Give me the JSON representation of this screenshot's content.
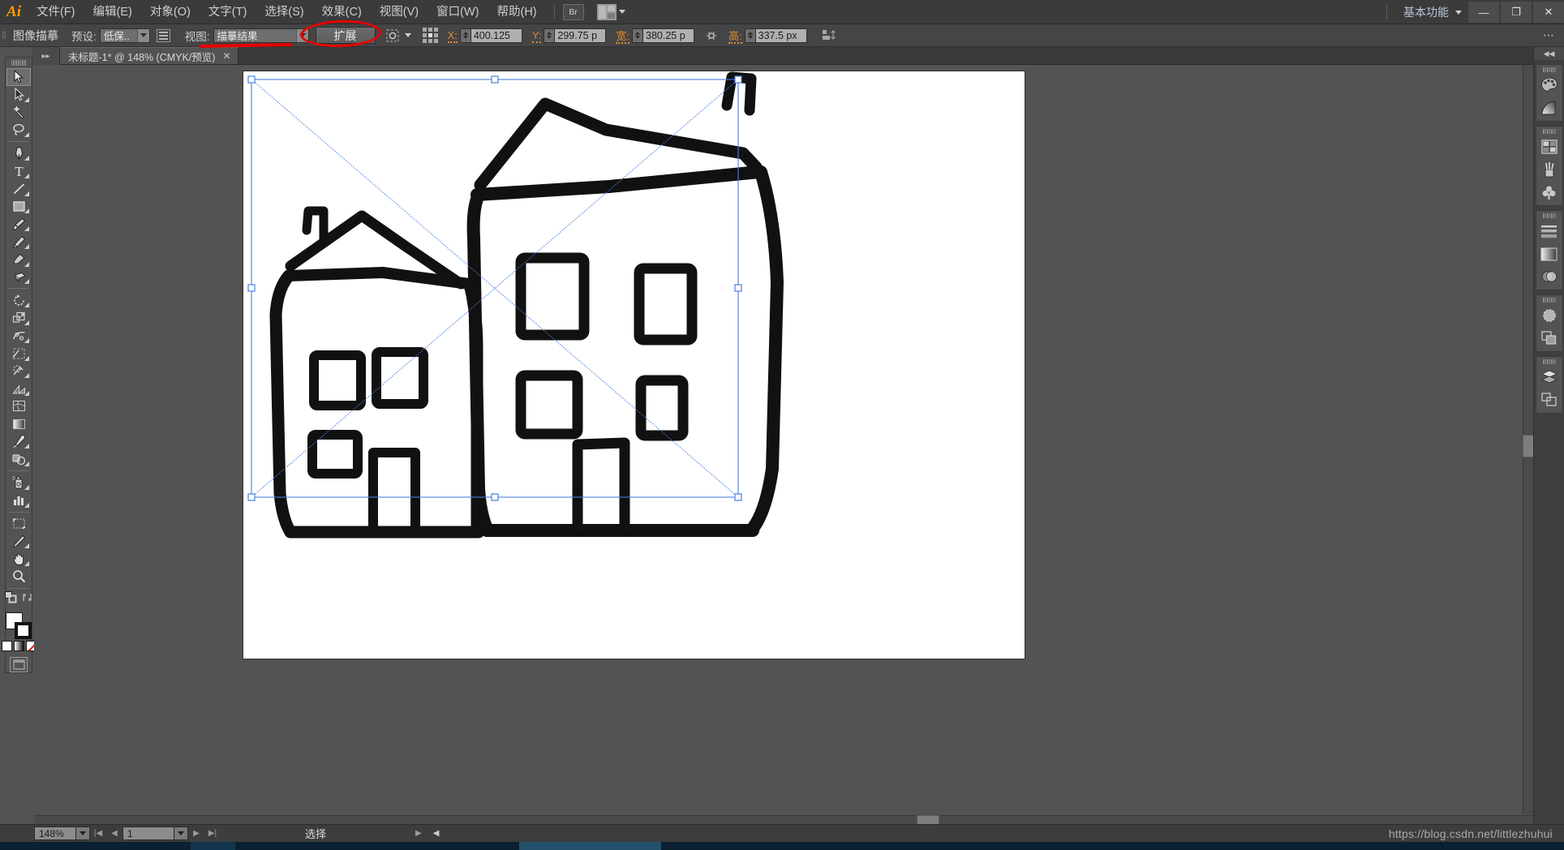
{
  "app": {
    "name": "Adobe Illustrator",
    "logo": "Ai"
  },
  "menubar": {
    "items": [
      {
        "label": "文件(F)"
      },
      {
        "label": "编辑(E)"
      },
      {
        "label": "对象(O)"
      },
      {
        "label": "文字(T)"
      },
      {
        "label": "选择(S)"
      },
      {
        "label": "效果(C)"
      },
      {
        "label": "视图(V)"
      },
      {
        "label": "窗口(W)"
      },
      {
        "label": "帮助(H)"
      }
    ],
    "bridge_label": "Br",
    "workspace": "基本功能",
    "window_controls": {
      "minimize": "—",
      "restore": "❐",
      "close": "✕"
    }
  },
  "controlbar": {
    "title": "图像描摹",
    "preset_label": "预设:",
    "preset_value": "低保..",
    "view_label": "视图:",
    "view_value": "描摹结果",
    "expand_button": "扩展",
    "x_label": "X:",
    "x_value": "400.125",
    "y_label": "Y:",
    "y_value": "299.75  p",
    "w_label": "宽:",
    "w_value": "380.25  p",
    "h_label": "高:",
    "h_value": "337.5  px",
    "menu_glyph": "⋯"
  },
  "document": {
    "tab_title": "未标题-1* @ 148% (CMYK/预览)",
    "close_glyph": "✕"
  },
  "toolbar": {
    "tools": [
      {
        "name": "selection-tool",
        "label": "选择工具",
        "active": true
      },
      {
        "name": "direct-selection-tool",
        "label": "直接选择工具",
        "active": false
      },
      {
        "name": "magic-wand-tool",
        "label": "魔棒工具",
        "active": false
      },
      {
        "name": "lasso-tool",
        "label": "套索工具",
        "active": false
      },
      {
        "name": "pen-tool",
        "label": "钢笔工具",
        "active": false
      },
      {
        "name": "type-tool",
        "label": "文字工具",
        "active": false
      },
      {
        "name": "line-segment-tool",
        "label": "直线段工具",
        "active": false
      },
      {
        "name": "rectangle-tool",
        "label": "矩形工具",
        "active": false
      },
      {
        "name": "paintbrush-tool",
        "label": "画笔工具",
        "active": false
      },
      {
        "name": "pencil-tool",
        "label": "铅笔工具",
        "active": false
      },
      {
        "name": "blob-brush-tool",
        "label": "斑点画笔工具",
        "active": false
      },
      {
        "name": "eraser-tool",
        "label": "橡皮擦工具",
        "active": false
      },
      {
        "name": "rotate-tool",
        "label": "旋转工具",
        "active": false
      },
      {
        "name": "scale-tool",
        "label": "比例缩放工具",
        "active": false
      },
      {
        "name": "width-tool",
        "label": "宽度工具",
        "active": false
      },
      {
        "name": "free-transform-tool",
        "label": "自由变换工具",
        "active": false
      },
      {
        "name": "shape-builder-tool",
        "label": "形状生成器工具",
        "active": false
      },
      {
        "name": "perspective-grid-tool",
        "label": "透视网格工具",
        "active": false
      },
      {
        "name": "mesh-tool",
        "label": "网格工具",
        "active": false
      },
      {
        "name": "gradient-tool",
        "label": "渐变工具",
        "active": false
      },
      {
        "name": "eyedropper-tool",
        "label": "吸管工具",
        "active": false
      },
      {
        "name": "blend-tool",
        "label": "混合工具",
        "active": false
      },
      {
        "name": "symbol-sprayer-tool",
        "label": "符号喷枪工具",
        "active": false
      },
      {
        "name": "column-graph-tool",
        "label": "柱形图工具",
        "active": false
      },
      {
        "name": "artboard-tool",
        "label": "画板工具",
        "active": false
      },
      {
        "name": "slice-tool",
        "label": "切片工具",
        "active": false
      },
      {
        "name": "hand-tool",
        "label": "抓手工具",
        "active": false
      },
      {
        "name": "zoom-tool",
        "label": "缩放工具",
        "active": false
      }
    ],
    "fill_color": "#ffffff",
    "stroke_color": "#111111",
    "color_swatches": [
      "白色",
      "渐变",
      "无"
    ]
  },
  "rightdock": {
    "collapse_glyph": "◀◀",
    "groups": [
      {
        "icons": [
          {
            "name": "color-panel-icon",
            "label": "颜色"
          },
          {
            "name": "color-guide-panel-icon",
            "label": "颜色参考"
          }
        ]
      },
      {
        "icons": [
          {
            "name": "swatches-panel-icon",
            "label": "色板"
          },
          {
            "name": "brushes-panel-icon",
            "label": "画笔"
          },
          {
            "name": "symbols-panel-icon",
            "label": "符号"
          }
        ]
      },
      {
        "icons": [
          {
            "name": "stroke-panel-icon",
            "label": "描边"
          },
          {
            "name": "gradient-panel-icon",
            "label": "渐变"
          },
          {
            "name": "transparency-panel-icon",
            "label": "透明度"
          }
        ]
      },
      {
        "icons": [
          {
            "name": "appearance-panel-icon",
            "label": "外观"
          },
          {
            "name": "graphic-styles-panel-icon",
            "label": "图形样式"
          }
        ]
      },
      {
        "icons": [
          {
            "name": "layers-panel-icon",
            "label": "图层"
          },
          {
            "name": "artboards-panel-icon",
            "label": "画板"
          }
        ]
      }
    ]
  },
  "statusbar": {
    "zoom": "148%",
    "page": "1",
    "status_text": "选择",
    "first_glyph": "|◀",
    "prev_glyph": "◀",
    "next_glyph": "▶",
    "last_glyph": "▶|",
    "expand_glyph": "▶",
    "collapse_glyph": "◀"
  },
  "watermark": "https://blog.csdn.net/littlezhuhui",
  "annotations": [
    {
      "name": "red-circle-expand-button",
      "target": "扩展",
      "color": "#e60000"
    },
    {
      "name": "red-underline-preset",
      "target": "预设",
      "color": "#e60000"
    }
  ],
  "artwork": {
    "title": "手绘房屋矢量图",
    "selection": {
      "visible": true,
      "handle_color": "#4a7fe0"
    }
  }
}
